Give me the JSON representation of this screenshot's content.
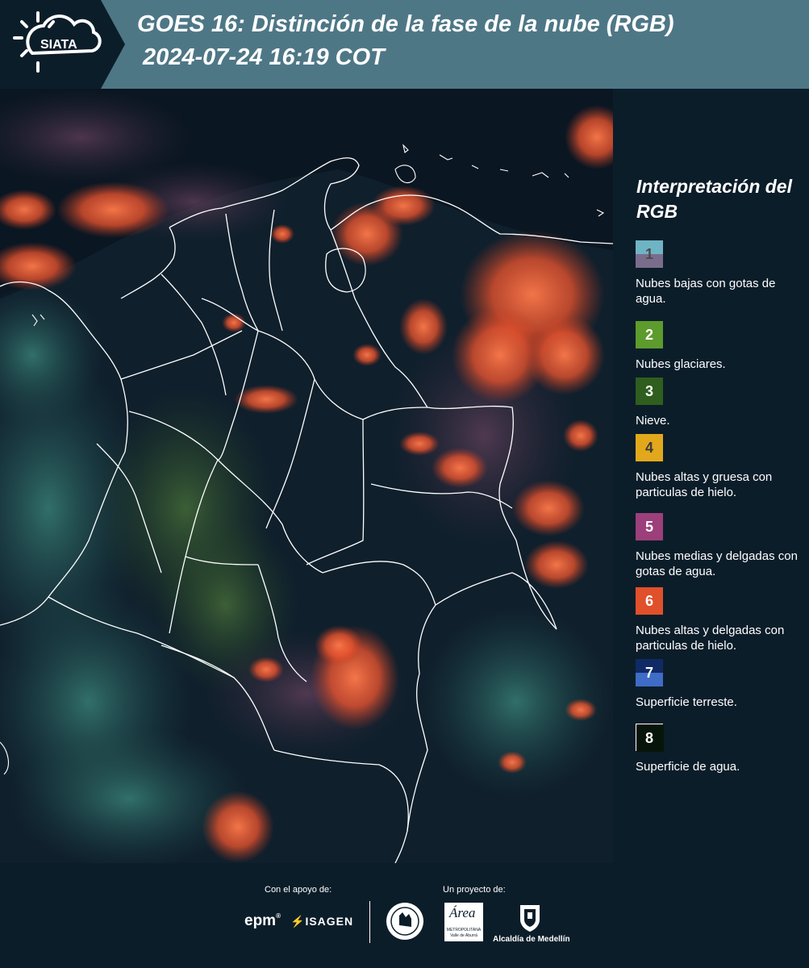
{
  "header": {
    "brand": "SIATA",
    "title_line1": "GOES 16: Distinción de la fase de la nube (RGB)",
    "title_line2": "2024-07-24 16:19 COT",
    "logo_icon": "sun-cloud-icon"
  },
  "map": {
    "description_icon": "satellite-rgb-map-colombia"
  },
  "legend": {
    "title": "Interpretación del RGB",
    "items": [
      {
        "num": "1",
        "label": "Nubes bajas con gotas de agua.",
        "color_top": "#6fb4c4",
        "color_bottom": "#7a6d8c",
        "num_color": "#4a4a4a"
      },
      {
        "num": "2",
        "label": "Nubes glaciares.",
        "color_top": "#5d9b2c",
        "color_bottom": "#5d9b2c",
        "num_color": "#ffffff"
      },
      {
        "num": "3",
        "label": "Nieve.",
        "color_top": "#2f5e1e",
        "color_bottom": "#2f5e1e",
        "num_color": "#ffffff"
      },
      {
        "num": "4",
        "label": "Nubes altas y gruesa con particulas de hielo.",
        "color_top": "#e2a81c",
        "color_bottom": "#e2a81c",
        "num_color": "#3a3a3a"
      },
      {
        "num": "5",
        "label": "Nubes medias y delgadas con gotas de agua.",
        "color_top": "#9c3f7a",
        "color_bottom": "#9c3f7a",
        "num_color": "#ffffff"
      },
      {
        "num": "6",
        "label": "Nubes altas y delgadas con particulas de hielo.",
        "color_top": "#e0502a",
        "color_bottom": "#e0502a",
        "num_color": "#ffffff"
      },
      {
        "num": "7",
        "label": "Superficie terreste.",
        "color_top": "#102a66",
        "color_bottom": "#3e6cc6",
        "num_color": "#ffffff"
      },
      {
        "num": "8",
        "label": "Superficie de agua.",
        "color_top": "#07140a",
        "color_bottom": "#07140a",
        "num_color": "#ffffff"
      }
    ]
  },
  "footer": {
    "support_label": "Con el apoyo de:",
    "project_label": "Un proyecto de:",
    "epm": "epm",
    "isagen": "ISAGEN",
    "area_metro_top": "Área",
    "area_metro_line1": "METROPOLITANA",
    "area_metro_line2": "Valle de Aburrá",
    "alcaldia": "Alcaldía de Medellín"
  }
}
